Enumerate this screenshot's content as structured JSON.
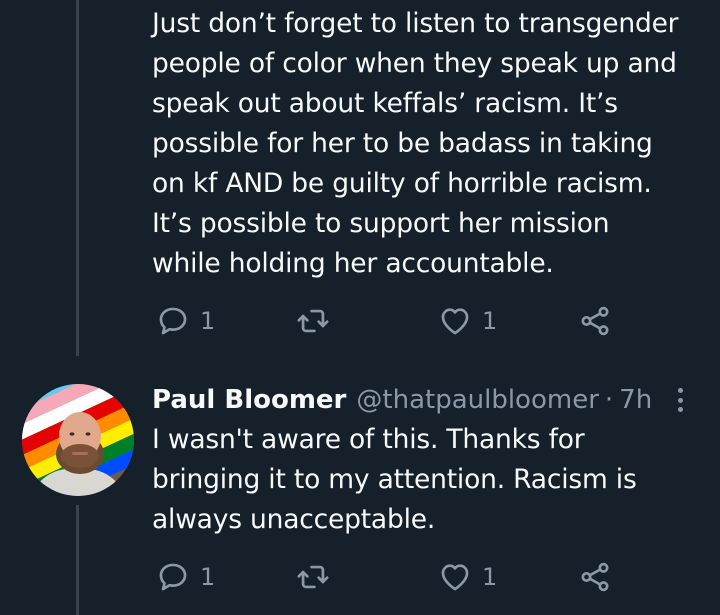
{
  "tweets": [
    {
      "text": "Just don’t forget to listen to transgender\npeople of color when they speak up and\nspeak out about keffals’ racism. It’s\npossible for her to be badass in taking\non kf AND be guilty of horrible racism.\nIt’s possible to support her mission\nwhile holding her accountable.",
      "reply_count": "1",
      "like_count": "1"
    },
    {
      "display_name": "Paul Bloomer",
      "handle": "@thatpaulbloomer",
      "separator": "·",
      "time": "7h",
      "text": "I wasn't aware of this. Thanks for\nbringing it to my attention. Racism is\nalways unacceptable.",
      "reply_count": "1",
      "like_count": "1"
    }
  ],
  "icons": {
    "reply": "speech-bubble-icon",
    "retweet": "retweet-arrows-icon",
    "like": "heart-icon",
    "share": "share-nodes-icon",
    "more": "vertical-ellipsis-icon"
  },
  "colors": {
    "background": "#15202b",
    "text": "#f7f9f9",
    "muted": "#8b98a5",
    "thread_line": "#38444d"
  }
}
